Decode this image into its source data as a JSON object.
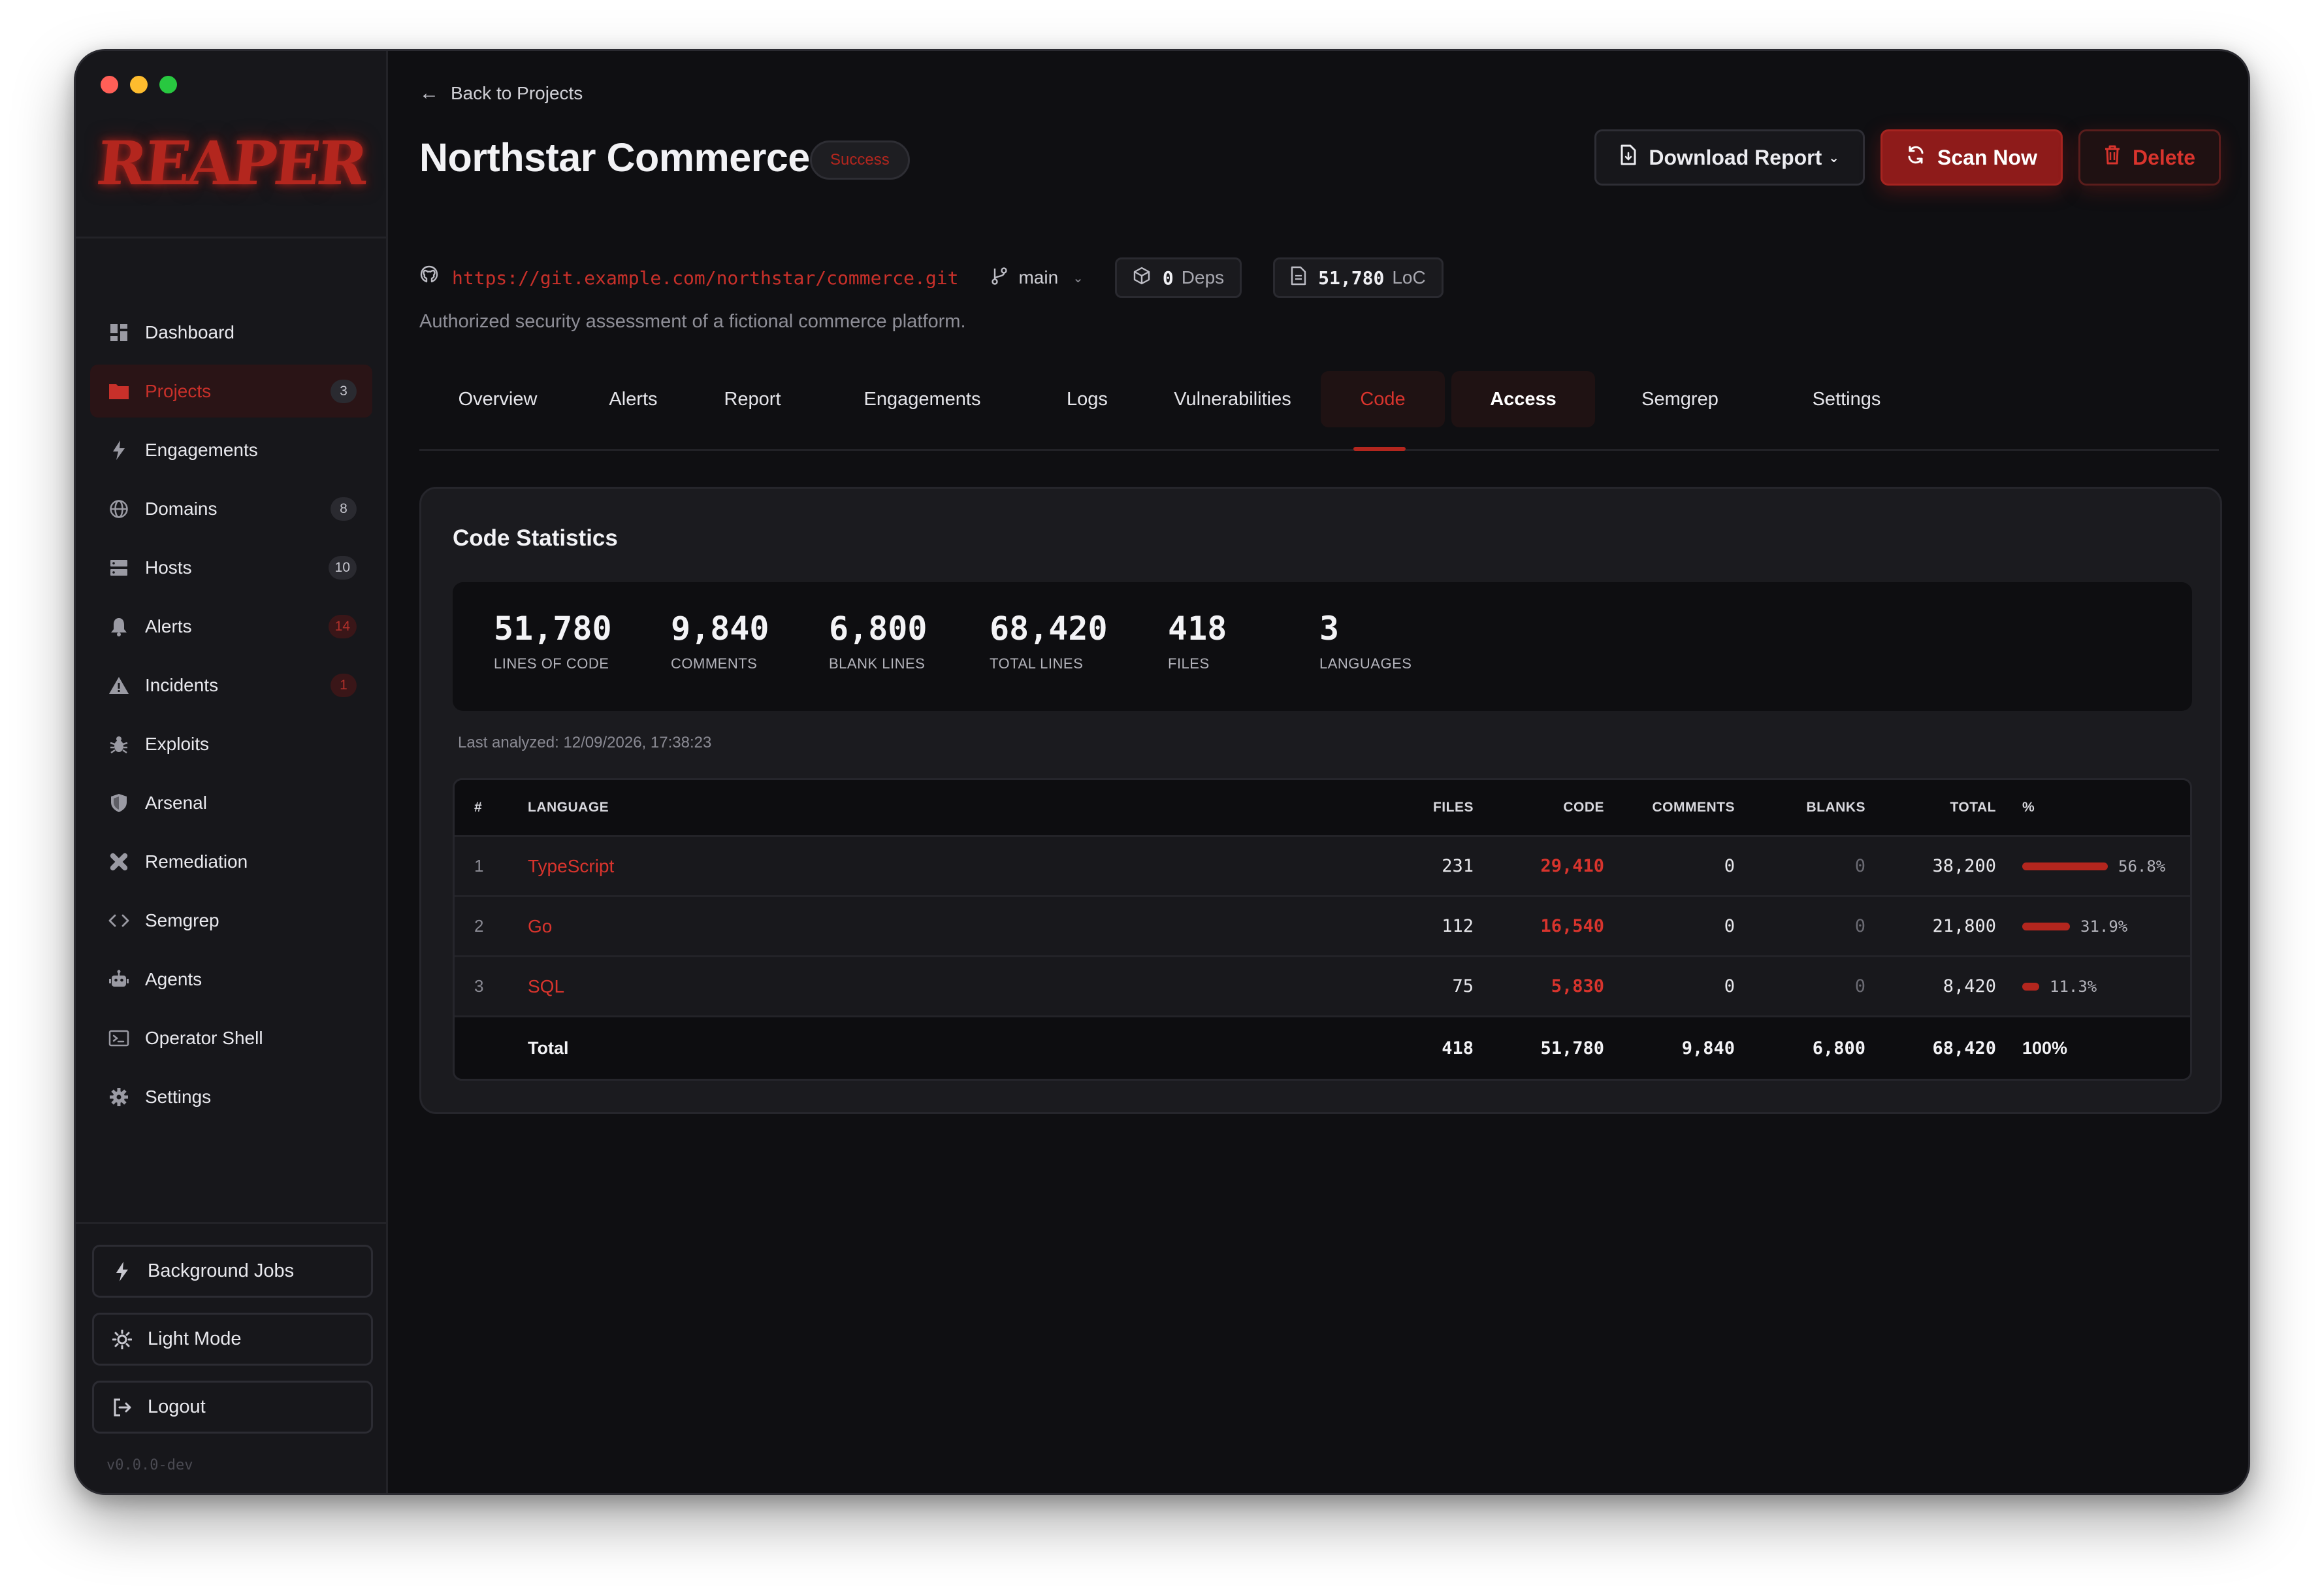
{
  "app": {
    "logo": "REAPER",
    "version": "v0.0.0-dev"
  },
  "sidebar": {
    "items": [
      {
        "label": "Dashboard",
        "icon": "grid-icon",
        "badge": ""
      },
      {
        "label": "Projects",
        "icon": "folder-icon",
        "badge": "3",
        "active": true
      },
      {
        "label": "Engagements",
        "icon": "bolt-icon",
        "badge": ""
      },
      {
        "label": "Domains",
        "icon": "globe-icon",
        "badge": "8"
      },
      {
        "label": "Hosts",
        "icon": "server-icon",
        "badge": "10"
      },
      {
        "label": "Alerts",
        "icon": "bell-icon",
        "badge": "14",
        "badge_red": true
      },
      {
        "label": "Incidents",
        "icon": "warning-icon",
        "badge": "1",
        "badge_red": true
      },
      {
        "label": "Exploits",
        "icon": "bug-icon",
        "badge": ""
      },
      {
        "label": "Arsenal",
        "icon": "shield-icon",
        "badge": ""
      },
      {
        "label": "Remediation",
        "icon": "bandage-icon",
        "badge": ""
      },
      {
        "label": "Semgrep",
        "icon": "code-icon",
        "badge": ""
      },
      {
        "label": "Agents",
        "icon": "robot-icon",
        "badge": ""
      },
      {
        "label": "Operator Shell",
        "icon": "terminal-icon",
        "badge": ""
      },
      {
        "label": "Settings",
        "icon": "gear-icon",
        "badge": ""
      }
    ],
    "bottom": {
      "jobs_label": "Background Jobs",
      "theme_label": "Light Mode",
      "logout_label": "Logout"
    }
  },
  "header": {
    "back_label": "Back to Projects",
    "title": "Northstar Commerce",
    "status": "Success",
    "repo_url": "https://git.example.com/northstar/commerce.git",
    "branch": "main",
    "deps_count": "0",
    "deps_label": "Deps",
    "loc_count": "51,780",
    "loc_label": "LoC",
    "description": "Authorized security assessment of a fictional commerce platform.",
    "download_label": "Download Report",
    "scan_label": "Scan Now",
    "delete_label": "Delete"
  },
  "tabs": [
    {
      "label": "Overview"
    },
    {
      "label": "Alerts"
    },
    {
      "label": "Report"
    },
    {
      "label": "Engagements"
    },
    {
      "label": "Logs"
    },
    {
      "label": "Vulnerabilities"
    },
    {
      "label": "Code",
      "active": true
    },
    {
      "label": "Access",
      "highlight": true
    },
    {
      "label": "Semgrep"
    },
    {
      "label": "Settings"
    }
  ],
  "code": {
    "title": "Code Statistics",
    "stats": [
      {
        "value": "51,780",
        "label": "LINES OF CODE"
      },
      {
        "value": "9,840",
        "label": "COMMENTS"
      },
      {
        "value": "6,800",
        "label": "BLANK LINES"
      },
      {
        "value": "68,420",
        "label": "TOTAL LINES"
      },
      {
        "value": "418",
        "label": "FILES"
      },
      {
        "value": "3",
        "label": "LANGUAGES"
      }
    ],
    "last_analyzed": "Last analyzed: 12/09/2026, 17:38:23",
    "table": {
      "headers": [
        "#",
        "LANGUAGE",
        "FILES",
        "CODE",
        "COMMENTS",
        "BLANKS",
        "TOTAL",
        "%"
      ],
      "rows": [
        {
          "idx": "1",
          "language": "TypeScript",
          "files": "231",
          "code": "29,410",
          "comments": "0",
          "blanks": "0",
          "total": "38,200",
          "pct": "56.8%",
          "share": 0.568
        },
        {
          "idx": "2",
          "language": "Go",
          "files": "112",
          "code": "16,540",
          "comments": "0",
          "blanks": "0",
          "total": "21,800",
          "pct": "31.9%",
          "share": 0.319
        },
        {
          "idx": "3",
          "language": "SQL",
          "files": "75",
          "code": "5,830",
          "comments": "0",
          "blanks": "0",
          "total": "8,420",
          "pct": "11.3%",
          "share": 0.113
        }
      ],
      "total": {
        "label": "Total",
        "files": "418",
        "code": "51,780",
        "comments": "9,840",
        "blanks": "6,800",
        "total": "68,420",
        "pct": "100%"
      }
    }
  },
  "colors": {
    "accent": "#b3261e",
    "accent_text": "#d8342d",
    "background": "#0f0f12",
    "sidebar": "#17171b"
  }
}
